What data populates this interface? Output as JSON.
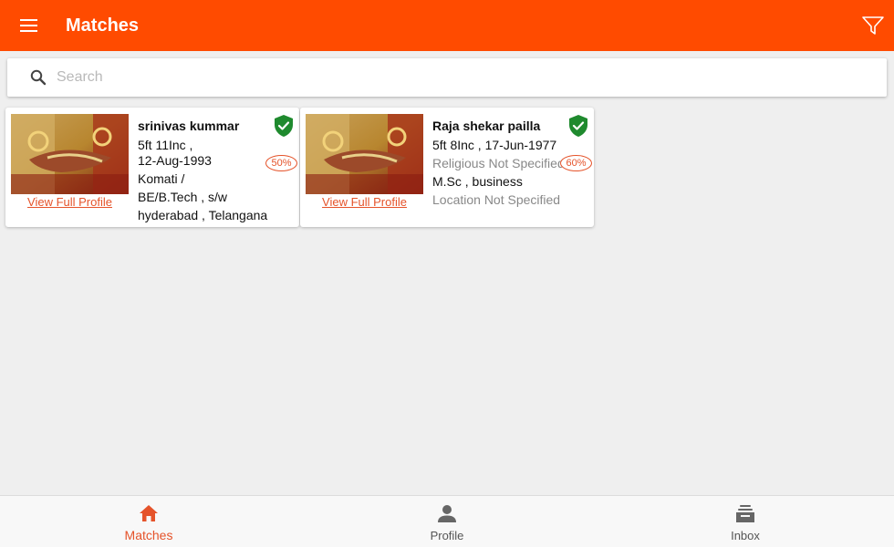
{
  "header": {
    "title": "Matches",
    "menu_icon": "hamburger-icon",
    "filter_icon": "filter-icon"
  },
  "search": {
    "placeholder": "Search",
    "value": ""
  },
  "matches": [
    {
      "name": "srinivas kummar",
      "line1": "5ft 11Inc ,",
      "line2": "12-Aug-1993",
      "line3": "Komati /",
      "line4": "BE/B.Tech ,  s/w",
      "line5": "hyderabad ,  Telangana",
      "percent": "50%",
      "view_label": "View Full Profile"
    },
    {
      "name": "Raja shekar pailla",
      "line1": "5ft 8Inc ,  17-Jun-1977",
      "line2": "Religious Not Specified",
      "line3": "M.Sc ,  business",
      "line4": "Location Not Specified",
      "percent": "60%",
      "view_label": "View Full Profile"
    }
  ],
  "bottom_nav": {
    "items": [
      {
        "label": "Matches",
        "icon": "home-icon",
        "active": true
      },
      {
        "label": "Profile",
        "icon": "person-icon",
        "active": false
      },
      {
        "label": "Inbox",
        "icon": "inbox-icon",
        "active": false
      }
    ]
  },
  "colors": {
    "primary": "#ff4b00",
    "accent": "#e5532a",
    "verified": "#1f8a2e",
    "background": "#efefef"
  }
}
